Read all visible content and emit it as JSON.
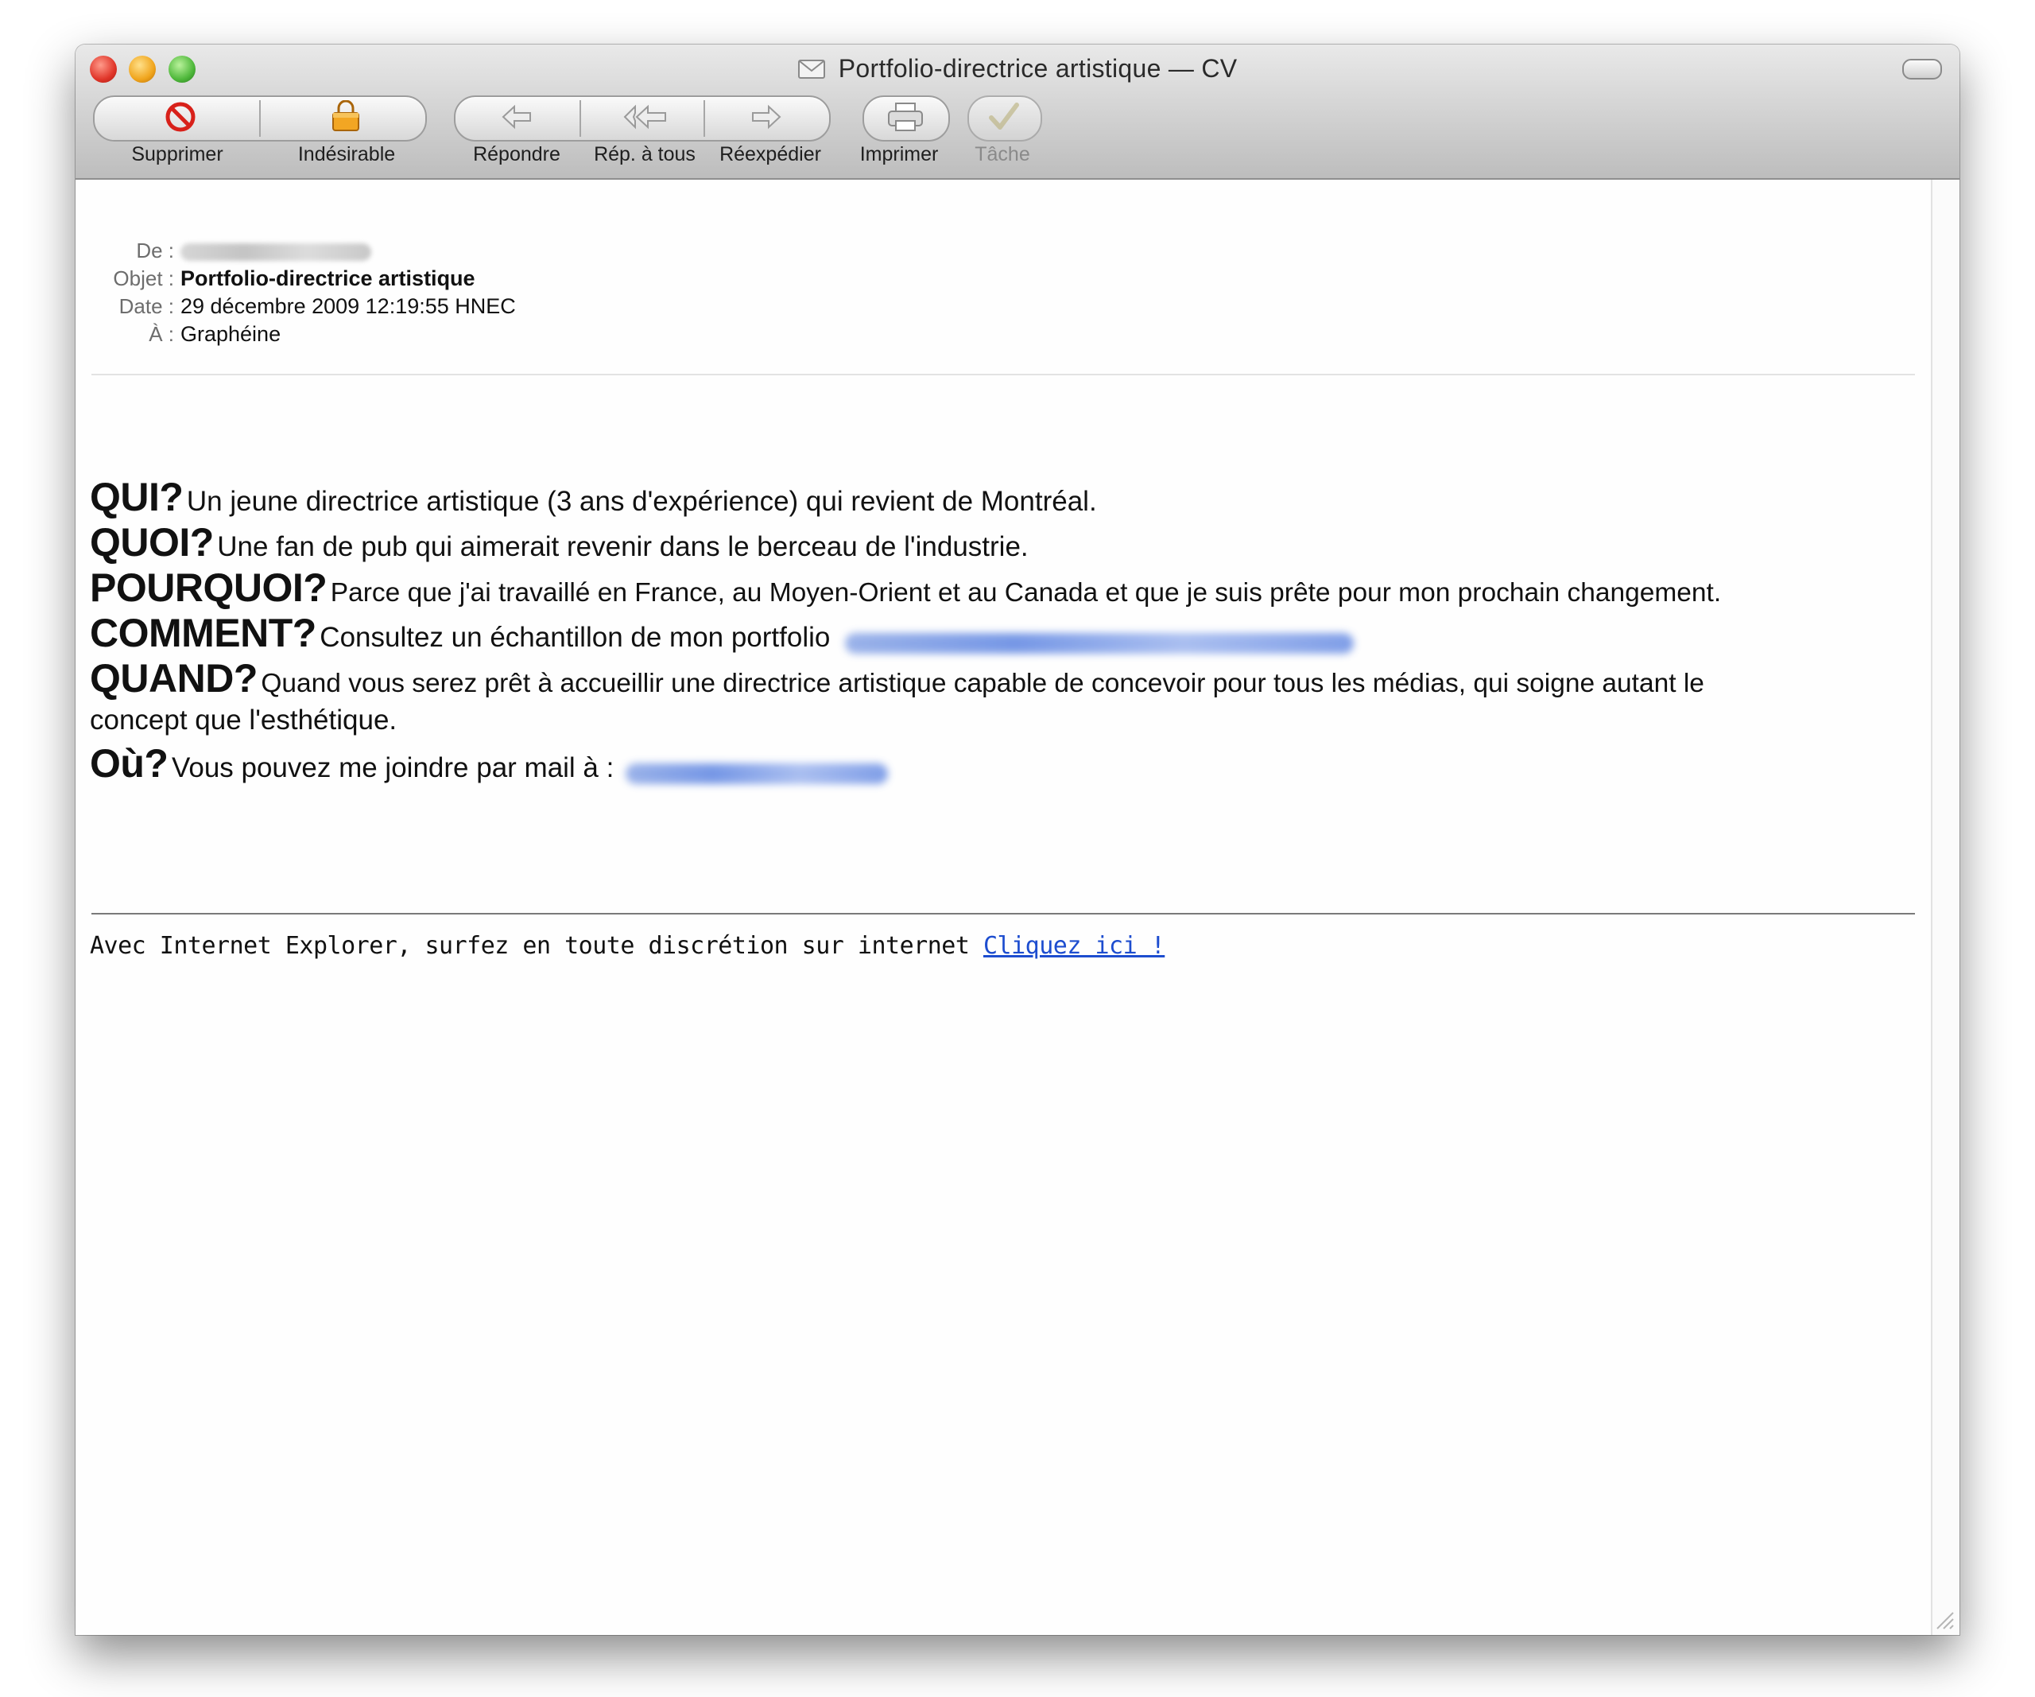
{
  "window": {
    "title": "Portfolio-directrice artistique — CV"
  },
  "toolbar": {
    "buttons": [
      {
        "label": "Supprimer",
        "icon": "delete-icon",
        "enabled": true
      },
      {
        "label": "Indésirable",
        "icon": "junk-icon",
        "enabled": true
      },
      {
        "label": "Répondre",
        "icon": "reply-icon",
        "enabled": true
      },
      {
        "label": "Rép. à tous",
        "icon": "reply-all-icon",
        "enabled": true
      },
      {
        "label": "Réexpédier",
        "icon": "forward-icon",
        "enabled": true
      },
      {
        "label": "Imprimer",
        "icon": "print-icon",
        "enabled": true
      },
      {
        "label": "Tâche",
        "icon": "task-checkmark-icon",
        "enabled": false
      }
    ]
  },
  "headers": {
    "from_label": "De :",
    "subject_label": "Objet :",
    "subject_value": "Portfolio-directrice artistique",
    "date_label": "Date :",
    "date_value": "29 décembre 2009 12:19:55 HNEC",
    "to_label": "À :",
    "to_value": "Graphéine"
  },
  "body": {
    "lines": [
      {
        "q": "QUI?",
        "a": "Un jeune directrice artistique (3 ans d'expérience) qui revient de Montréal."
      },
      {
        "q": "QUOI?",
        "a": "Une fan de pub qui aimerait revenir dans le berceau de l'industrie."
      },
      {
        "q": "POURQUOI?",
        "a": "Parce que j'ai travaillé en France, au Moyen-Orient et au Canada et que je suis prête pour mon prochain changement."
      },
      {
        "q": "COMMENT?",
        "a": "Consultez un échantillon de mon portfolio"
      },
      {
        "q": "QUAND?",
        "a": "Quand vous serez prêt à accueillir une directrice artistique capable de concevoir pour tous les médias, qui soigne autant le",
        "a2": "concept que l'esthétique."
      },
      {
        "q": "Où?",
        "a": "Vous pouvez me joindre par mail à :"
      }
    ]
  },
  "footer": {
    "text": "Avec Internet Explorer, surfez en toute discrétion sur internet",
    "link": "Cliquez ici !"
  }
}
